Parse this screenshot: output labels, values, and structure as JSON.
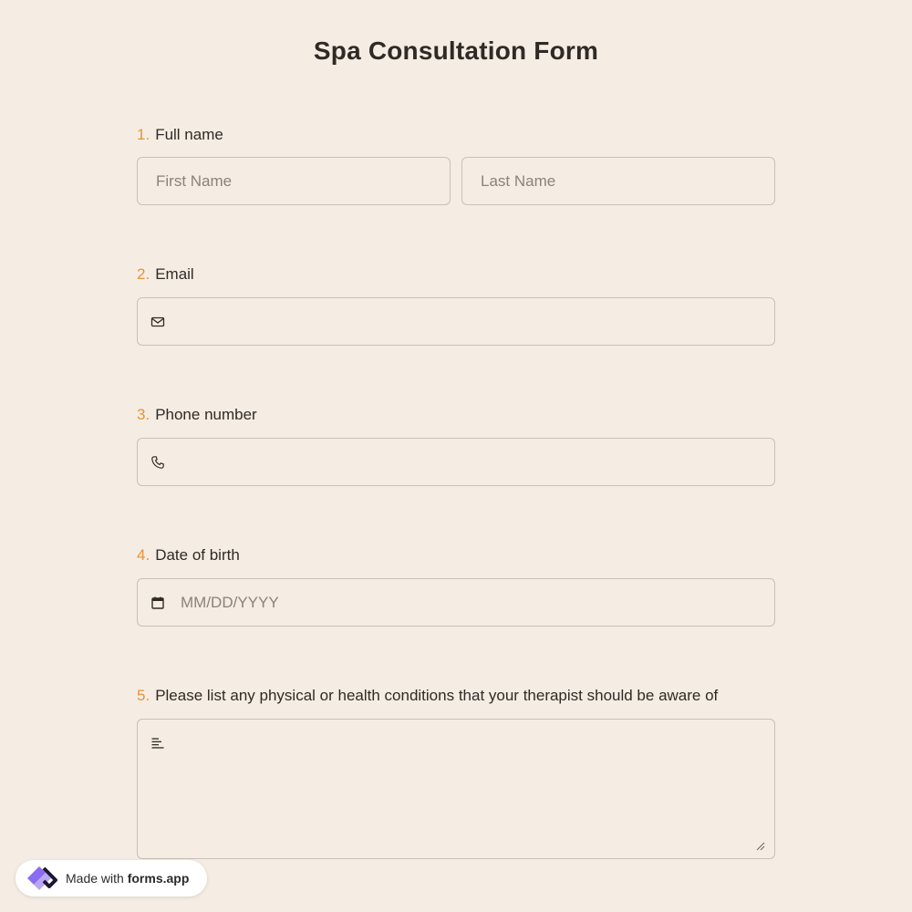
{
  "form": {
    "title": "Spa Consultation Form"
  },
  "questions": [
    {
      "number": "1.",
      "label": "Full name",
      "first_placeholder": "First Name",
      "last_placeholder": "Last Name"
    },
    {
      "number": "2.",
      "label": "Email",
      "icon": "envelope-icon"
    },
    {
      "number": "3.",
      "label": "Phone number",
      "icon": "phone-icon"
    },
    {
      "number": "4.",
      "label": "Date of birth",
      "icon": "calendar-icon",
      "placeholder": "MM/DD/YYYY"
    },
    {
      "number": "5.",
      "label": "Please list any physical or health conditions that your therapist should be aware of",
      "icon": "text-lines-icon"
    }
  ],
  "footer": {
    "made_with": "Made with",
    "brand": "forms.app"
  },
  "colors": {
    "background": "#f5ede3",
    "accent": "#e8923a",
    "border": "#c9c0b6",
    "text": "#2f2a26"
  }
}
